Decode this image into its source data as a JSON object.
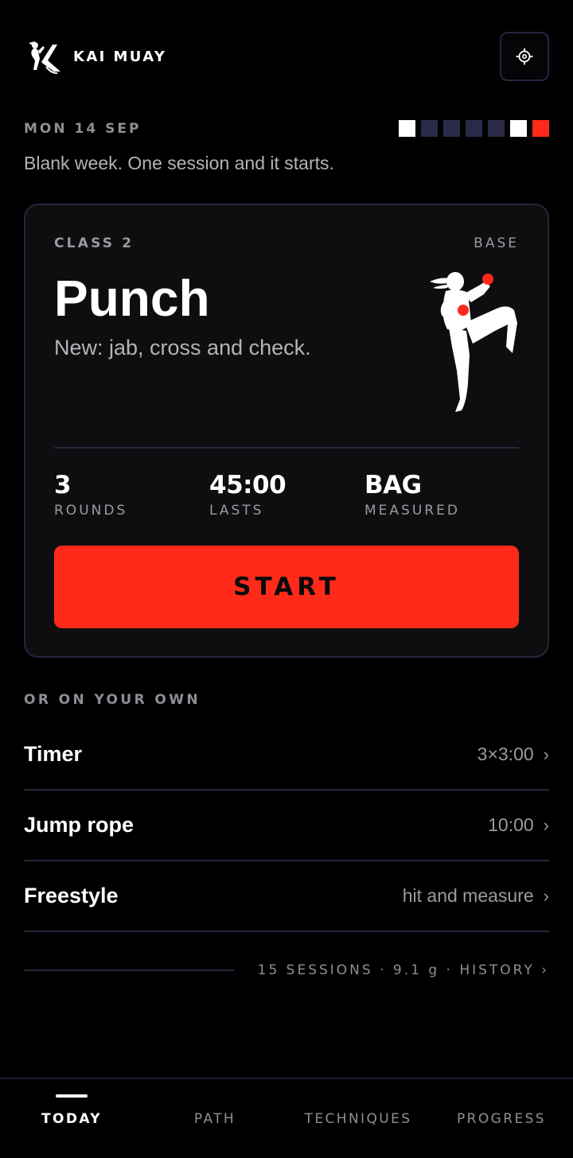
{
  "header": {
    "brand": "KAI MUAY",
    "logo_icon": "fighter-k-logo",
    "settings_icon": "gear-icon"
  },
  "today": {
    "date": "MON 14 SEP",
    "tagline": "Blank week. One session and it starts.",
    "week_states": [
      "done",
      "empty",
      "empty",
      "empty",
      "empty",
      "done",
      "today"
    ]
  },
  "card": {
    "class_label": "CLASS 2",
    "level": "BASE",
    "title": "Punch",
    "description": "New: jab, cross and check.",
    "stats": [
      {
        "value": "3",
        "label": "ROUNDS"
      },
      {
        "value": "45:00",
        "label": "LASTS"
      },
      {
        "value": "BAG",
        "label": "MEASURED"
      }
    ],
    "start_label": "START"
  },
  "own": {
    "heading": "OR ON YOUR OWN",
    "items": [
      {
        "title": "Timer",
        "value": "3×3:00"
      },
      {
        "title": "Jump rope",
        "value": "10:00"
      },
      {
        "title": "Freestyle",
        "value": "hit and measure"
      }
    ]
  },
  "history": {
    "text": "15 SESSIONS · 9.1 g · HISTORY ›"
  },
  "tabs": [
    {
      "label": "TODAY",
      "active": true
    },
    {
      "label": "PATH",
      "active": false
    },
    {
      "label": "TECHNIQUES",
      "active": false
    },
    {
      "label": "PROGRESS",
      "active": false
    }
  ],
  "colors": {
    "accent": "#ff2a1a",
    "background": "#000000",
    "card": "#0e0e10",
    "border": "#26263c",
    "muted": "#8e8e96",
    "week_empty": "#2a2a48",
    "week_done": "#ffffff"
  }
}
